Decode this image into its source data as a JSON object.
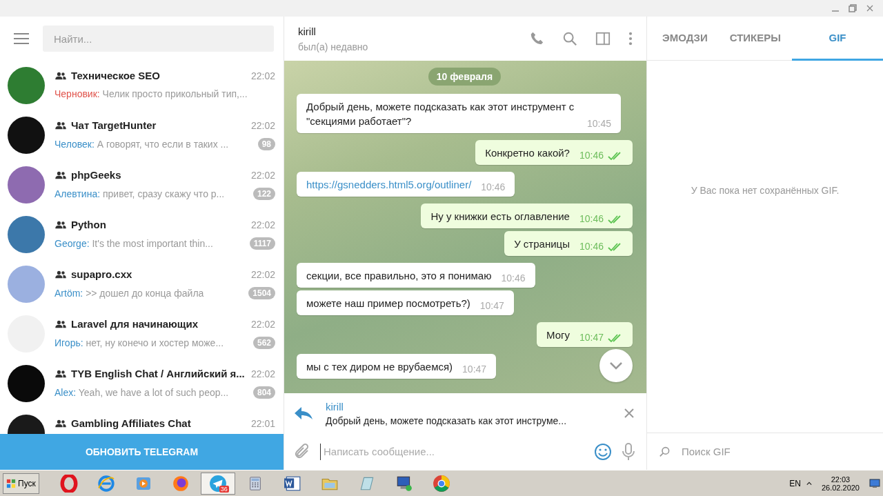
{
  "sidebar": {
    "search": {
      "placeholder": "Найти..."
    },
    "chats": [
      {
        "title": "Техническое SEO",
        "time": "22:02",
        "sender": "Черновик:",
        "draft": true,
        "preview": "Челик просто прикольный тип,...",
        "color": "#2e7d32"
      },
      {
        "title": "Чат TargetHunter",
        "time": "22:02",
        "sender": "Человек:",
        "draft": false,
        "preview": "А говорят, что если в таких ...",
        "unread": "98",
        "color": "#111111"
      },
      {
        "title": "phpGeeks",
        "time": "22:02",
        "sender": "Алевтина:",
        "draft": false,
        "preview": "привет, сразу скажу что р...",
        "unread": "122",
        "color": "#8e6bb0"
      },
      {
        "title": "Python",
        "time": "22:02",
        "sender": "George:",
        "draft": false,
        "preview": "It's the most important thin...",
        "unread": "1117",
        "color": "#3c78aa"
      },
      {
        "title": "supapro.cxx",
        "time": "22:02",
        "sender": "Artöm:",
        "draft": false,
        "preview": ">> дошел до конца файла",
        "unread": "1504",
        "color": "#9bb0e0"
      },
      {
        "title": "Laravel для начинающих",
        "time": "22:02",
        "sender": "Игорь:",
        "draft": false,
        "preview": "нет, ну конечо и хостер може...",
        "unread": "562",
        "color": "#f1f1f1"
      },
      {
        "title": "TYB English Chat / Английский я...",
        "time": "22:02",
        "sender": "Alex:",
        "draft": false,
        "preview": "Yeah, we have a lot of such peop...",
        "unread": "804",
        "color": "#0a0a0a"
      },
      {
        "title": "Gambling Affiliates Chat",
        "time": "22:01",
        "color": "#1a1a1a"
      }
    ],
    "update_button": "ОБНОВИТЬ TELEGRAM"
  },
  "chat": {
    "name": "kirill",
    "status": "был(а) недавно",
    "date": "10 февраля",
    "messages": [
      {
        "kind": "in",
        "text": "Добрый день, можете подсказать как этот инструмент с \"секциями работает\"?",
        "time": "10:45"
      },
      {
        "kind": "out",
        "text": "Конкретно какой?",
        "time": "10:46",
        "read": true
      },
      {
        "kind": "link",
        "text": "https://gsnedders.html5.org/outliner/",
        "time": "10:46"
      },
      {
        "kind": "out",
        "text": "Ну у книжки есть оглавление",
        "time": "10:46",
        "read": true
      },
      {
        "kind": "out",
        "text": "У страницы",
        "time": "10:46",
        "read": true
      },
      {
        "kind": "in",
        "text": "секции, все правильно, это я понимаю",
        "time": "10:46"
      },
      {
        "kind": "in",
        "text": "можете наш пример посмотреть?)",
        "time": "10:47"
      },
      {
        "kind": "out",
        "text": "Могу",
        "time": "10:47",
        "read": true
      },
      {
        "kind": "in",
        "text": "мы с тех диром не врубаемся)",
        "time": "10:47"
      }
    ],
    "reply": {
      "author": "kirill",
      "text": "Добрый день, можете подсказать как этот инструме..."
    },
    "input": {
      "placeholder": "Написать сообщение..."
    }
  },
  "panel": {
    "tabs": [
      {
        "label": "ЭМОДЗИ",
        "selected": false
      },
      {
        "label": "СТИКЕРЫ",
        "selected": false
      },
      {
        "label": "GIF",
        "selected": true
      }
    ],
    "empty_text": "У Вас пока нет сохранённых GIF.",
    "search": {
      "placeholder": "Поиск GIF"
    }
  },
  "taskbar": {
    "start": "Пуск",
    "apps": [
      {
        "kind": "ring",
        "selected": false
      },
      {
        "kind": "ie",
        "selected": false
      },
      {
        "kind": "player",
        "selected": false
      },
      {
        "kind": "fox",
        "selected": false
      },
      {
        "kind": "plane",
        "selected": true,
        "badge": "36"
      },
      {
        "kind": "calc",
        "selected": false
      },
      {
        "kind": "doc",
        "selected": false
      },
      {
        "kind": "folder",
        "selected": false
      },
      {
        "kind": "notebook",
        "selected": false
      },
      {
        "kind": "computer",
        "selected": false
      },
      {
        "kind": "wheel",
        "selected": false
      }
    ],
    "language": "EN",
    "time": "22:03",
    "date": "26.02.2020"
  }
}
